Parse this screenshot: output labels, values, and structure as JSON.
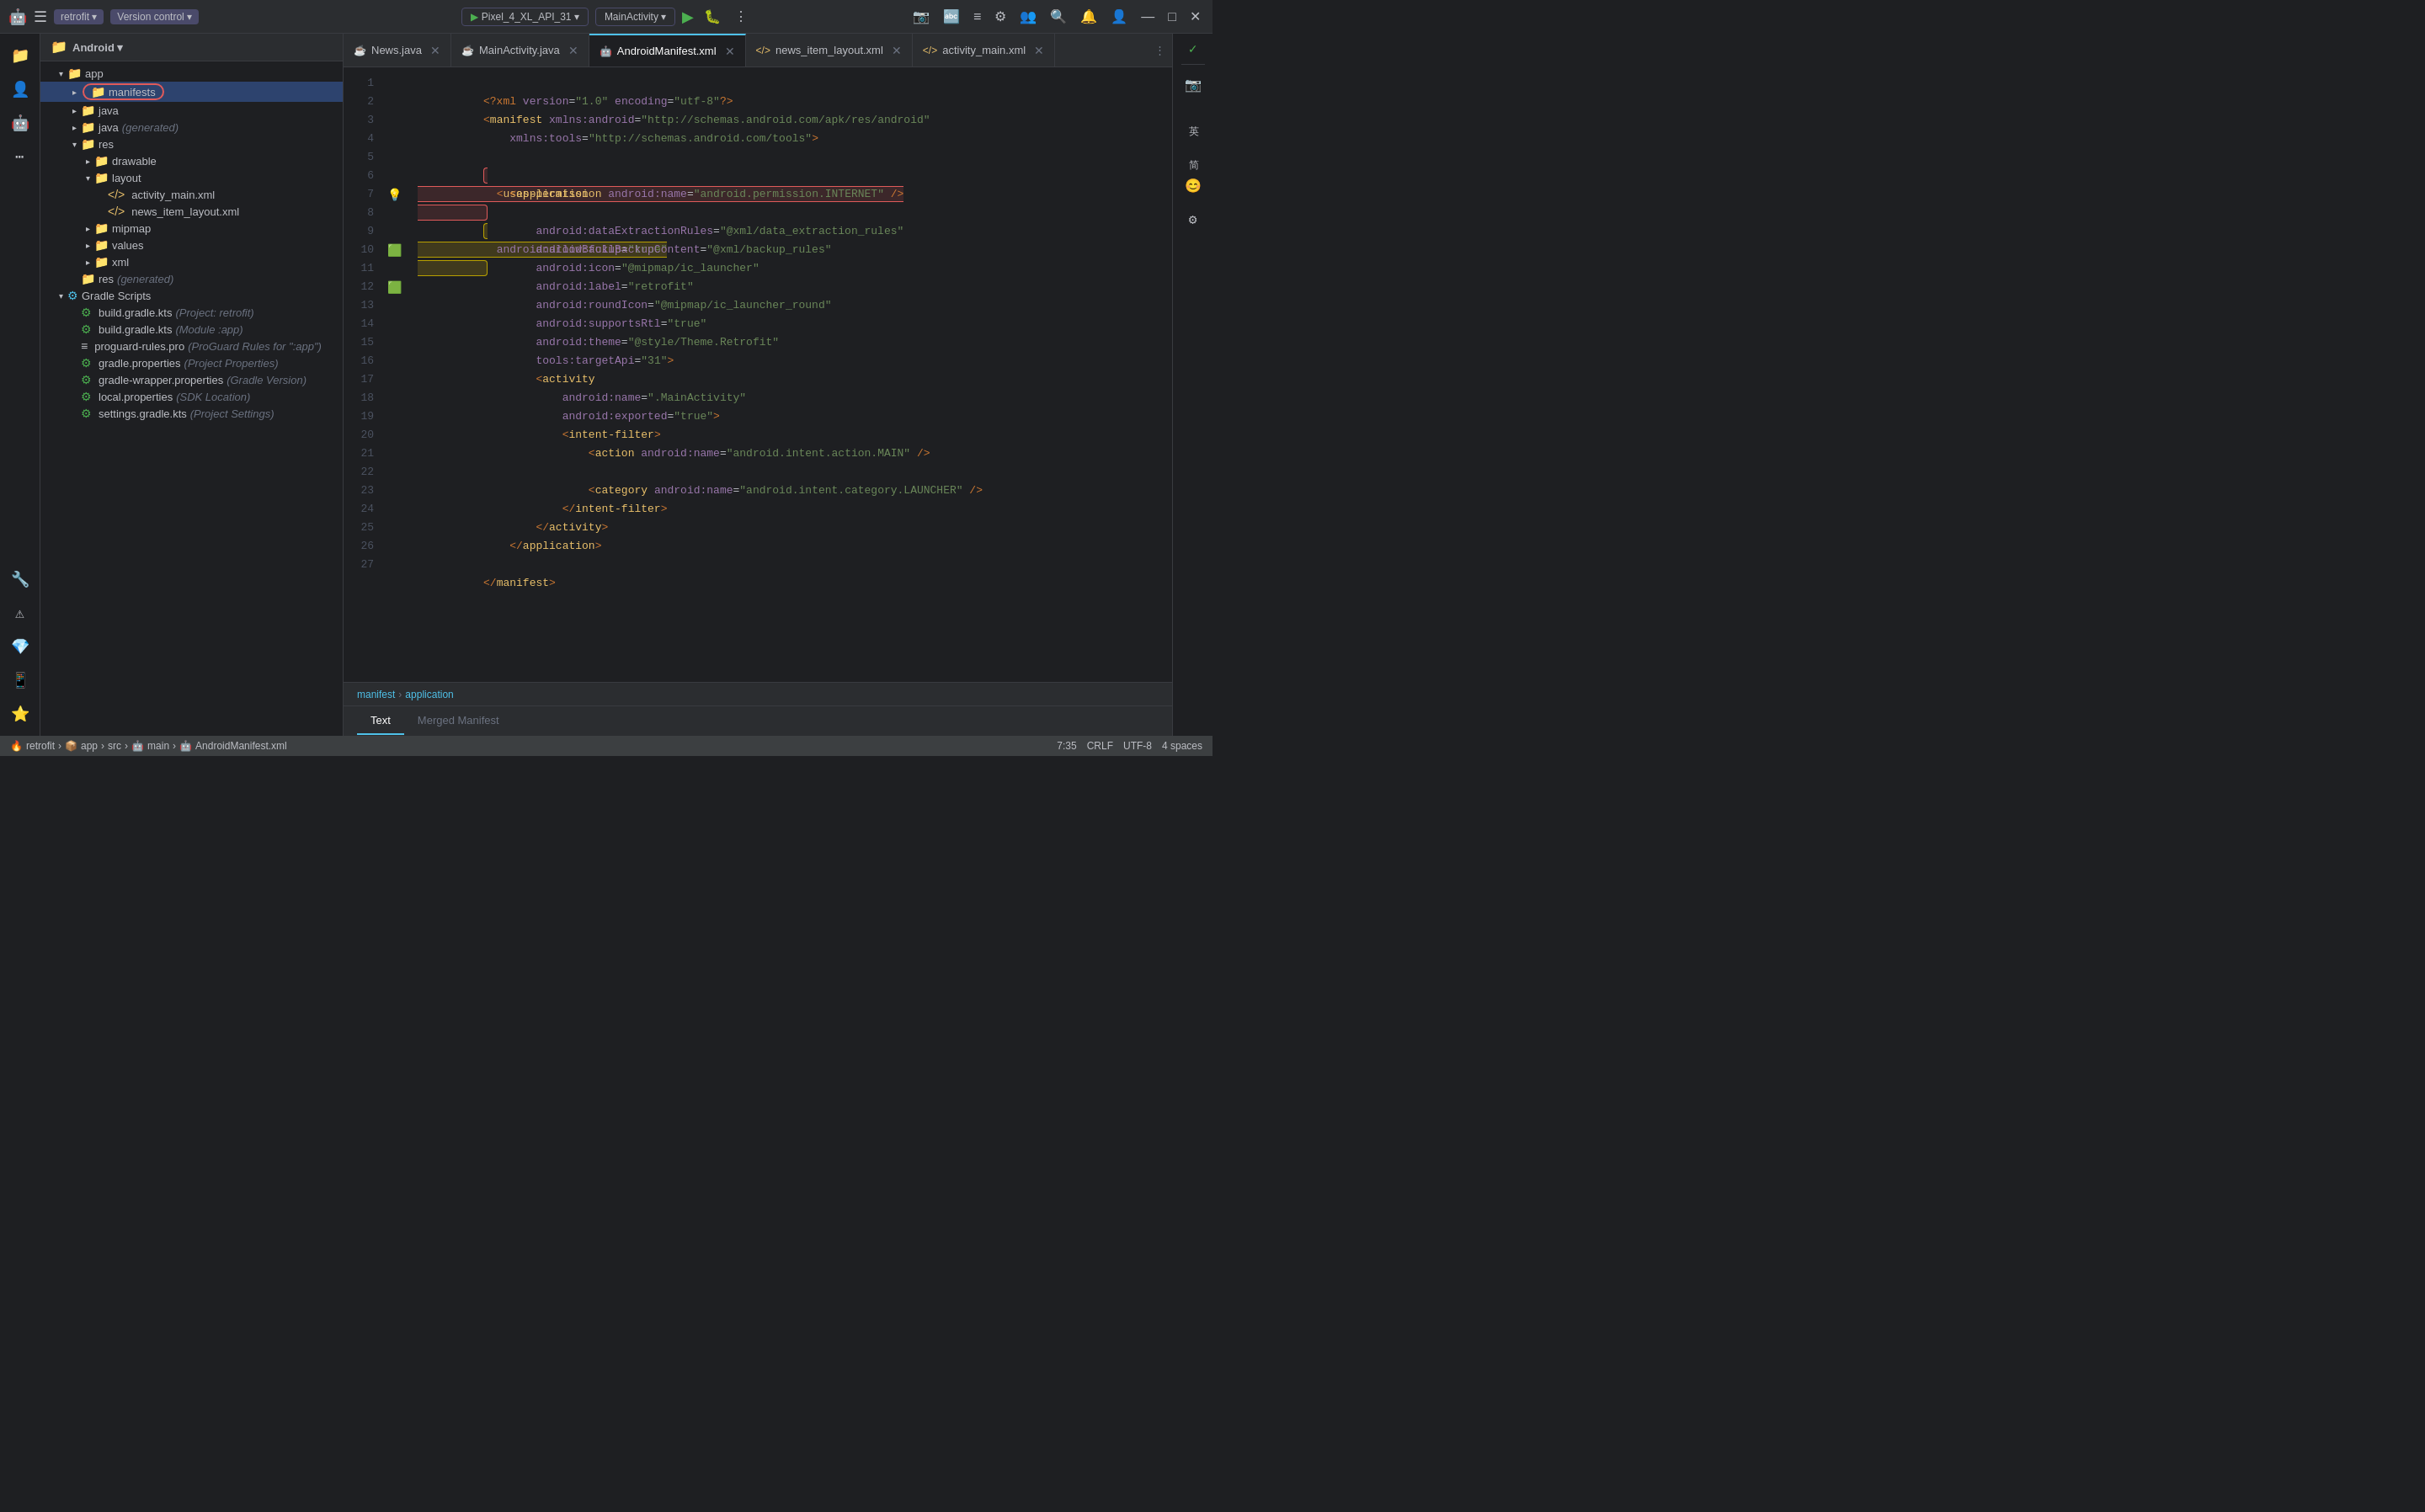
{
  "titleBar": {
    "appIcon": "🤖",
    "menuItems": [
      "retrofit ▾",
      "Version control ▾"
    ],
    "deviceLabel": "Pixel_4_XL_API_31 ▾",
    "mainActivityLabel": "MainActivity ▾",
    "runIcon": "▶",
    "debugIcon": "🐛",
    "moreIcon": "⋮",
    "rightIcons": [
      "📷",
      "🔤",
      "≡",
      "⚙",
      "👥",
      "🔍",
      "🔔",
      "👤",
      "—",
      "□",
      "✕"
    ]
  },
  "sidebar": {
    "title": "Android ▾",
    "tree": [
      {
        "id": "app",
        "label": "app",
        "indent": 1,
        "arrow": "▾",
        "icon": "📁",
        "type": "folder"
      },
      {
        "id": "manifests",
        "label": "manifests",
        "indent": 2,
        "arrow": "▸",
        "icon": "📁",
        "type": "folder",
        "highlighted": true
      },
      {
        "id": "java",
        "label": "java",
        "indent": 2,
        "arrow": "▸",
        "icon": "📁",
        "type": "folder"
      },
      {
        "id": "java-gen",
        "label": "java (generated)",
        "indent": 2,
        "arrow": "▸",
        "icon": "📁",
        "type": "folder"
      },
      {
        "id": "res",
        "label": "res",
        "indent": 2,
        "arrow": "▾",
        "icon": "📁",
        "type": "folder"
      },
      {
        "id": "drawable",
        "label": "drawable",
        "indent": 3,
        "arrow": "▸",
        "icon": "📁",
        "type": "folder"
      },
      {
        "id": "layout",
        "label": "layout",
        "indent": 3,
        "arrow": "▾",
        "icon": "📁",
        "type": "folder"
      },
      {
        "id": "activity_main",
        "label": "activity_main.xml",
        "indent": 4,
        "arrow": "",
        "icon": "</>",
        "type": "xml"
      },
      {
        "id": "news_item_layout",
        "label": "news_item_layout.xml",
        "indent": 4,
        "arrow": "",
        "icon": "</>",
        "type": "xml"
      },
      {
        "id": "mipmap",
        "label": "mipmap",
        "indent": 3,
        "arrow": "▸",
        "icon": "📁",
        "type": "folder"
      },
      {
        "id": "values",
        "label": "values",
        "indent": 3,
        "arrow": "▸",
        "icon": "📁",
        "type": "folder"
      },
      {
        "id": "xml",
        "label": "xml",
        "indent": 3,
        "arrow": "▸",
        "icon": "📁",
        "type": "folder"
      },
      {
        "id": "res-gen",
        "label": "res (generated)",
        "indent": 2,
        "arrow": "",
        "icon": "📁",
        "type": "folder"
      },
      {
        "id": "gradle-scripts",
        "label": "Gradle Scripts",
        "indent": 1,
        "arrow": "▾",
        "icon": "⚙",
        "type": "folder"
      },
      {
        "id": "build-gradle-project",
        "label": "build.gradle.kts",
        "secondary": "(Project: retrofit)",
        "indent": 2,
        "arrow": "",
        "icon": "⚙",
        "type": "gradle"
      },
      {
        "id": "build-gradle-module",
        "label": "build.gradle.kts",
        "secondary": "(Module :app)",
        "indent": 2,
        "arrow": "",
        "icon": "⚙",
        "type": "gradle"
      },
      {
        "id": "proguard",
        "label": "proguard-rules.pro",
        "secondary": "(ProGuard Rules for \":app\")",
        "indent": 2,
        "arrow": "",
        "icon": "≡",
        "type": "props"
      },
      {
        "id": "gradle-props",
        "label": "gradle.properties",
        "secondary": "(Project Properties)",
        "indent": 2,
        "arrow": "",
        "icon": "⚙",
        "type": "gradle"
      },
      {
        "id": "gradle-wrapper",
        "label": "gradle-wrapper.properties",
        "secondary": "(Gradle Version)",
        "indent": 2,
        "arrow": "",
        "icon": "⚙",
        "type": "gradle"
      },
      {
        "id": "local-props",
        "label": "local.properties",
        "secondary": "(SDK Location)",
        "indent": 2,
        "arrow": "",
        "icon": "⚙",
        "type": "gradle"
      },
      {
        "id": "settings-gradle",
        "label": "settings.gradle.kts",
        "secondary": "(Project Settings)",
        "indent": 2,
        "arrow": "",
        "icon": "⚙",
        "type": "gradle"
      }
    ]
  },
  "tabs": [
    {
      "id": "news-java",
      "label": "News.java",
      "icon": "☕",
      "active": false
    },
    {
      "id": "mainactivity-java",
      "label": "MainActivity.java",
      "icon": "☕",
      "active": false
    },
    {
      "id": "androidmanifest",
      "label": "AndroidManifest.xml",
      "icon": "🤖",
      "active": true
    },
    {
      "id": "news-item-layout",
      "label": "news_item_layout.xml",
      "icon": "</>",
      "active": false
    },
    {
      "id": "activity-main",
      "label": "activity_main.xml",
      "icon": "</>",
      "active": false
    }
  ],
  "code": {
    "lines": [
      {
        "num": 1,
        "content": "<?xml version=\"1.0\" encoding=\"utf-8\"?>",
        "gutter": ""
      },
      {
        "num": 2,
        "content": "<manifest xmlns:android=\"http://schemas.android.com/apk/res/android\"",
        "gutter": ""
      },
      {
        "num": 3,
        "content": "    xmlns:tools=\"http://schemas.android.com/tools\">",
        "gutter": ""
      },
      {
        "num": 4,
        "content": "    <uses-permission android:name=\"android.permission.INTERNET\" />",
        "gutter": "",
        "highlight": "red"
      },
      {
        "num": 5,
        "content": "",
        "gutter": ""
      },
      {
        "num": 6,
        "content": "    <application",
        "gutter": ""
      },
      {
        "num": 7,
        "content": "        android:allowBackup=\"true\"",
        "gutter": "lightbulb",
        "highlight": "yellow"
      },
      {
        "num": 8,
        "content": "        android:dataExtractionRules=\"@xml/data_extraction_rules\"",
        "gutter": ""
      },
      {
        "num": 9,
        "content": "        android:fullBackupContent=\"@xml/backup_rules\"",
        "gutter": ""
      },
      {
        "num": 10,
        "content": "        android:icon=\"@mipmap/ic_launcher\"",
        "gutter": "green"
      },
      {
        "num": 11,
        "content": "        android:label=\"retrofit\"",
        "gutter": ""
      },
      {
        "num": 12,
        "content": "        android:roundIcon=\"@mipmap/ic_launcher_round\"",
        "gutter": "green"
      },
      {
        "num": 13,
        "content": "        android:supportsRtl=\"true\"",
        "gutter": ""
      },
      {
        "num": 14,
        "content": "        android:theme=\"@style/Theme.Retrofit\"",
        "gutter": ""
      },
      {
        "num": 15,
        "content": "        tools:targetApi=\"31\">",
        "gutter": ""
      },
      {
        "num": 16,
        "content": "        <activity",
        "gutter": ""
      },
      {
        "num": 17,
        "content": "            android:name=\".MainActivity\"",
        "gutter": ""
      },
      {
        "num": 18,
        "content": "            android:exported=\"true\">",
        "gutter": ""
      },
      {
        "num": 19,
        "content": "            <intent-filter>",
        "gutter": ""
      },
      {
        "num": 20,
        "content": "                <action android:name=\"android.intent.action.MAIN\" />",
        "gutter": ""
      },
      {
        "num": 21,
        "content": "",
        "gutter": ""
      },
      {
        "num": 22,
        "content": "                <category android:name=\"android.intent.category.LAUNCHER\" />",
        "gutter": ""
      },
      {
        "num": 23,
        "content": "            </intent-filter>",
        "gutter": ""
      },
      {
        "num": 24,
        "content": "        </activity>",
        "gutter": ""
      },
      {
        "num": 25,
        "content": "    </application>",
        "gutter": ""
      },
      {
        "num": 26,
        "content": "",
        "gutter": ""
      },
      {
        "num": 27,
        "content": "</manifest>",
        "gutter": ""
      }
    ]
  },
  "breadcrumb": {
    "items": [
      "manifest",
      "application"
    ]
  },
  "bottomTabs": [
    {
      "label": "Text",
      "active": true
    },
    {
      "label": "Merged Manifest",
      "active": false
    }
  ],
  "statusBar": {
    "projectPath": "retrofit",
    "appPath": "app",
    "srcPath": "src",
    "mainPath": "main",
    "filePath": "AndroidManifest.xml",
    "position": "7:35",
    "lineEnding": "CRLF",
    "encoding": "UTF-8",
    "indent": "4 spaces"
  },
  "rightSidebar": {
    "icons": [
      "📷",
      "🔤",
      "⋮",
      "简",
      "😊",
      "⚙"
    ]
  }
}
